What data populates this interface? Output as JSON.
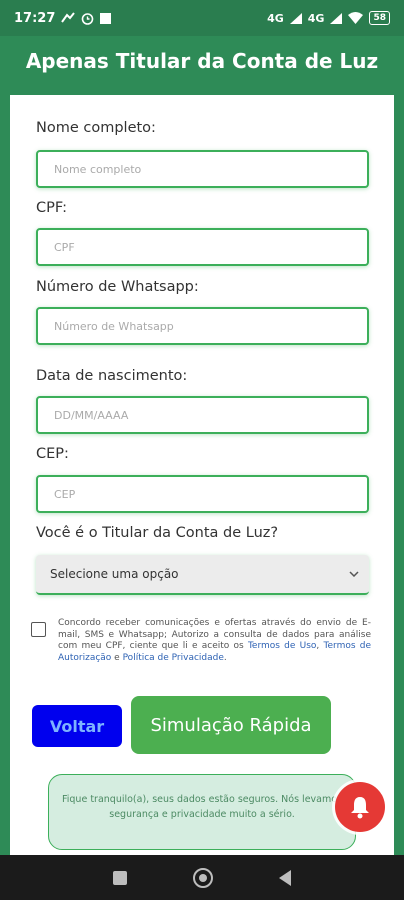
{
  "status_bar": {
    "time": "17:27",
    "network_1": "4G",
    "network_2": "4G",
    "battery": "58"
  },
  "header": {
    "title": "Apenas Titular da Conta de Luz"
  },
  "form": {
    "name_label": "Nome completo:",
    "name_placeholder": "Nome completo",
    "cpf_label": "CPF:",
    "cpf_placeholder": "CPF",
    "whatsapp_label": "Número de Whatsapp:",
    "whatsapp_placeholder": "Número de Whatsapp",
    "birth_label": "Data de nascimento:",
    "birth_placeholder": "DD/MM/AAAA",
    "cep_label": "CEP:",
    "cep_placeholder": "CEP",
    "titular_label": "Você é o Titular da Conta de Luz?",
    "titular_select_value": "Selecione uma opção"
  },
  "consent": {
    "text_before": "Concordo receber comunicações e ofertas através do envio de E-mail, SMS e Whatsapp; Autorizo a consulta de dados para análise com meu CPF, ciente que li e aceito os ",
    "link_terms_use": "Termos de Uso",
    "sep_1": ", ",
    "link_terms_auth": "Termos de Autorização",
    "sep_2": " e ",
    "link_privacy": "Política de Privacidade",
    "text_end": "."
  },
  "buttons": {
    "back": "Voltar",
    "simulate": "Simulação Rápida"
  },
  "safety_message": "Fique tranquilo(a), seus dados estão seguros. Nós levamos segurança e privacidade muito a sério.",
  "colors": {
    "brand_green": "#2e8b57",
    "field_border": "#3caf5a",
    "back_button": "#0000ee",
    "simulate_button": "#4caf50",
    "notification": "#e53935"
  }
}
